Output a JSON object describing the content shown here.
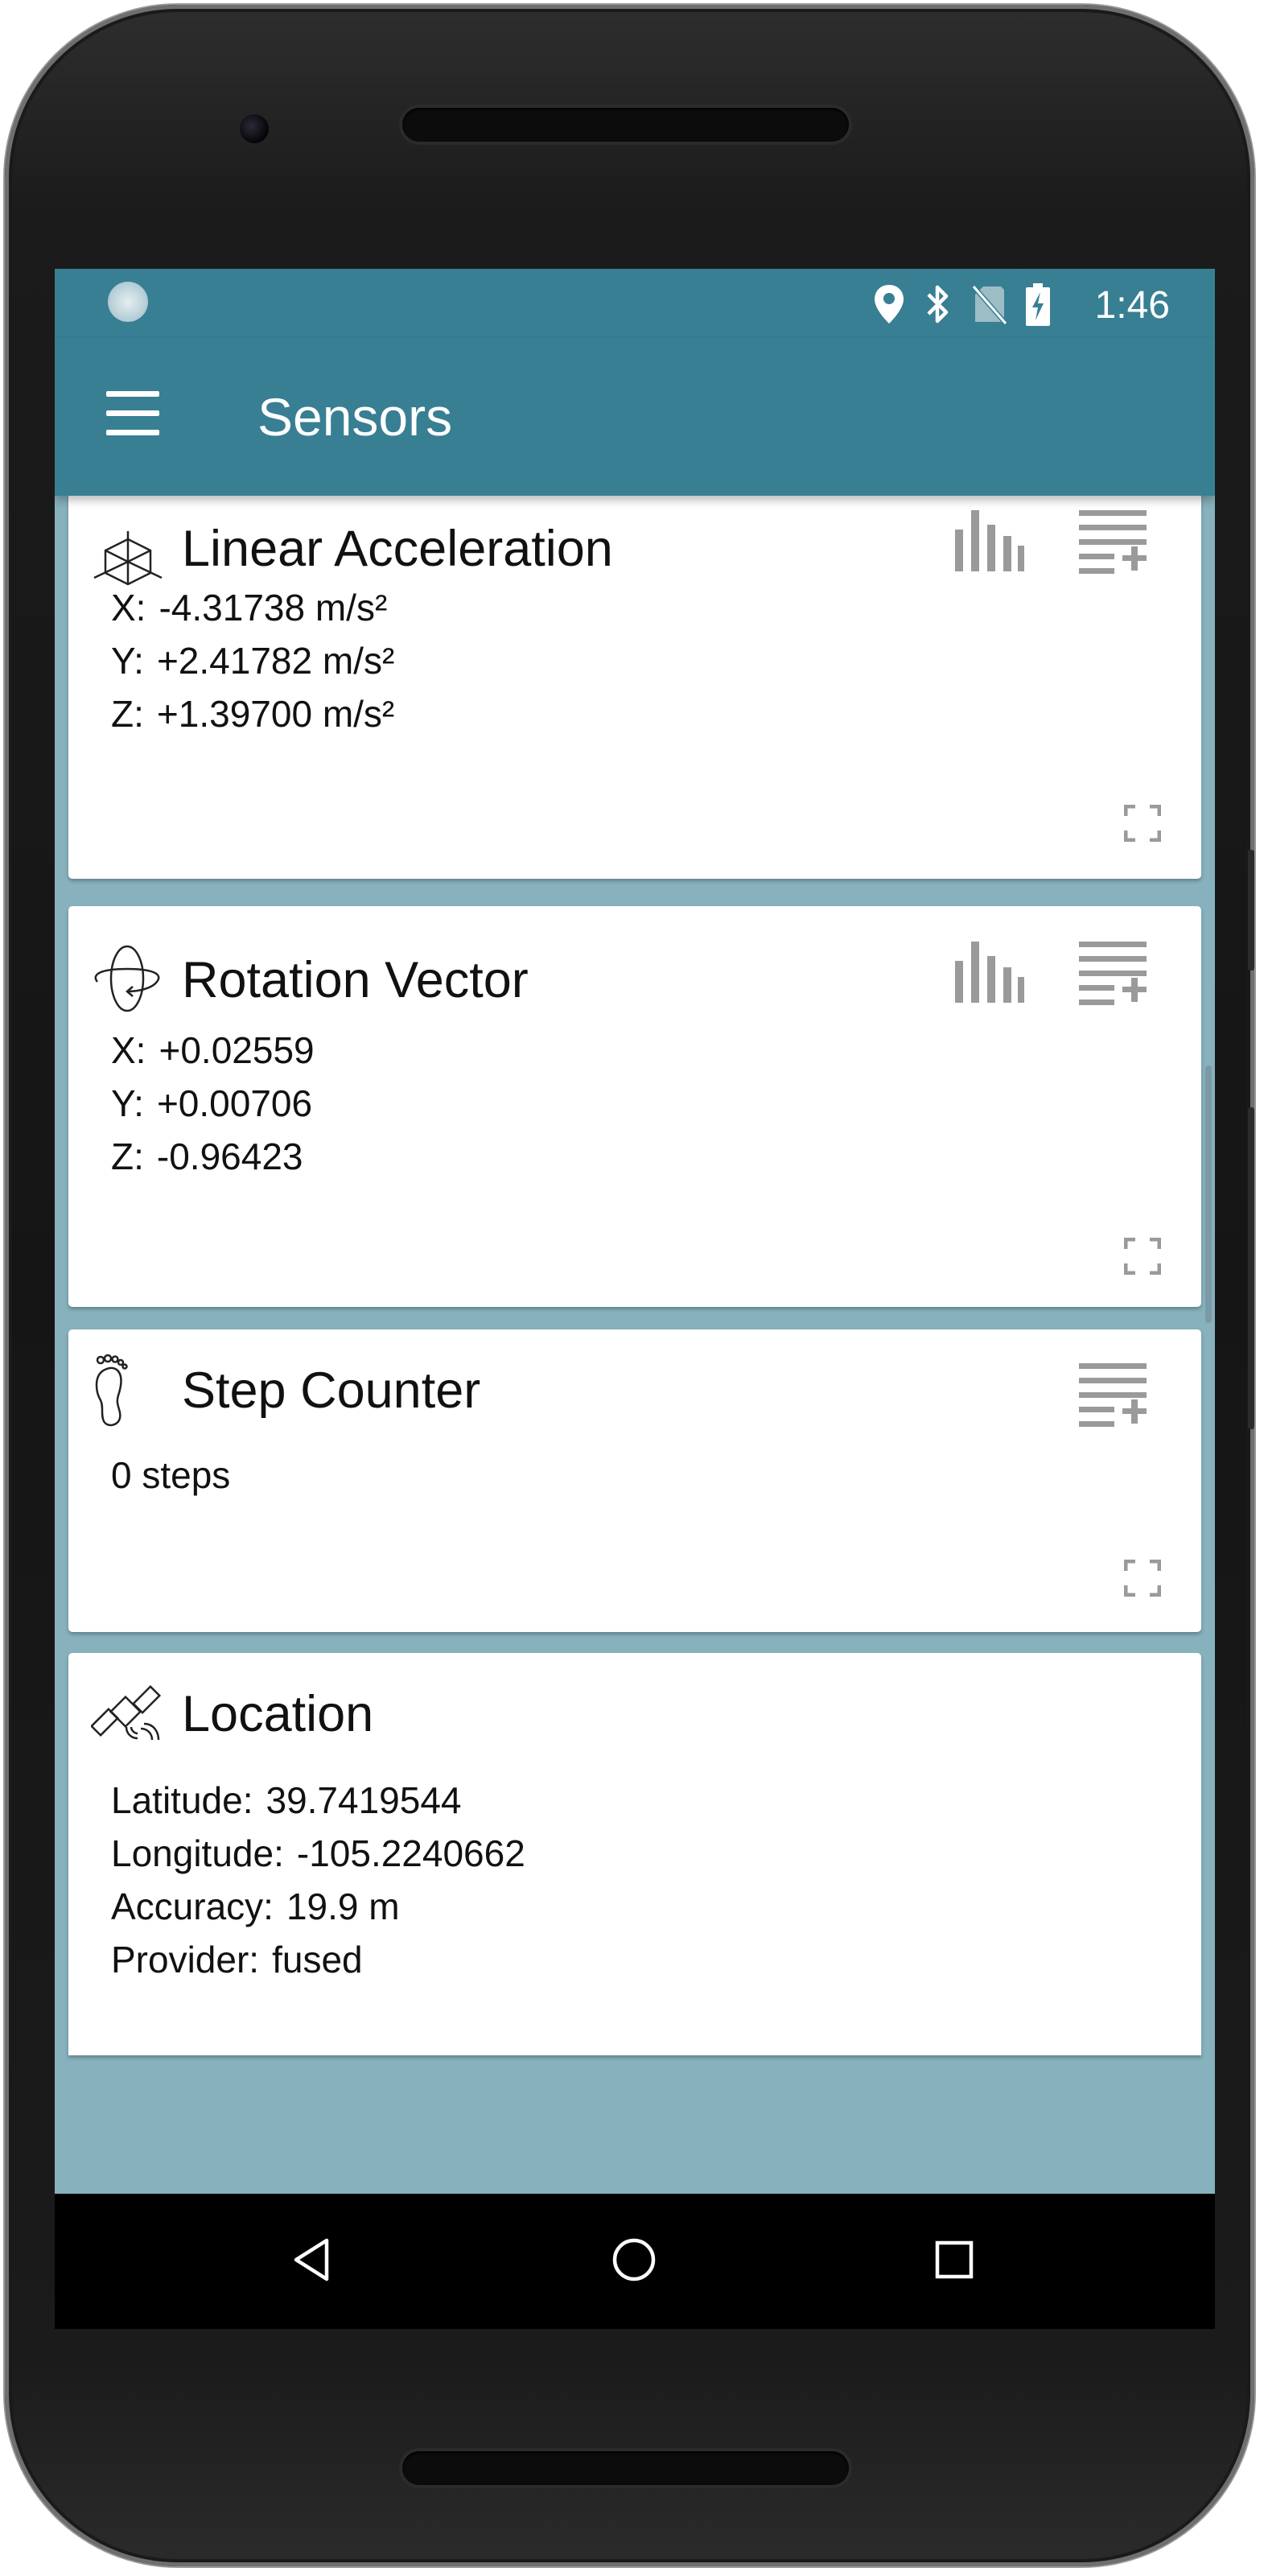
{
  "status_bar": {
    "time": "1:46",
    "icons": [
      "sync-indicator-icon",
      "location-pin-icon",
      "bluetooth-icon",
      "no-sim-icon",
      "battery-charging-icon"
    ]
  },
  "app_bar": {
    "title": "Sensors",
    "menu_icon": "hamburger-menu-icon"
  },
  "cards": {
    "linear_acceleration": {
      "title": "Linear Acceleration",
      "icon": "cube-axes-icon",
      "rows": [
        {
          "label": "X:",
          "value": " -4.31738 m/s²"
        },
        {
          "label": "Y:",
          "value": "+2.41782 m/s²"
        },
        {
          "label": "Z:",
          "value": "+1.39700 m/s²"
        }
      ]
    },
    "rotation_vector": {
      "title": "Rotation Vector",
      "icon": "rotation-orbit-icon",
      "rows": [
        {
          "label": "X:",
          "value": "+0.02559"
        },
        {
          "label": "Y:",
          "value": "+0.00706"
        },
        {
          "label": "Z:",
          "value": " -0.96423"
        }
      ]
    },
    "step_counter": {
      "title": "Step Counter",
      "icon": "footprint-icon",
      "value": "0 steps"
    },
    "location": {
      "title": "Location",
      "icon": "satellite-icon",
      "rows": [
        {
          "label": "Latitude:",
          "value": "39.7419544"
        },
        {
          "label": "Longitude:",
          "value": "-105.2240662"
        },
        {
          "label": "Accuracy:",
          "value": "19.9 m"
        },
        {
          "label": "Provider:",
          "value": "fused"
        }
      ]
    }
  },
  "actions": {
    "chart_icon": "bar-chart-icon",
    "log_icon": "playlist-add-icon",
    "expand_icon": "fullscreen-icon"
  },
  "nav_bar": {
    "back_icon": "back-triangle-icon",
    "home_icon": "home-circle-icon",
    "recents_icon": "recents-square-icon"
  },
  "colors": {
    "primary": "#387f93",
    "background": "#86b1bd",
    "action_icon": "#9a9a9a"
  }
}
